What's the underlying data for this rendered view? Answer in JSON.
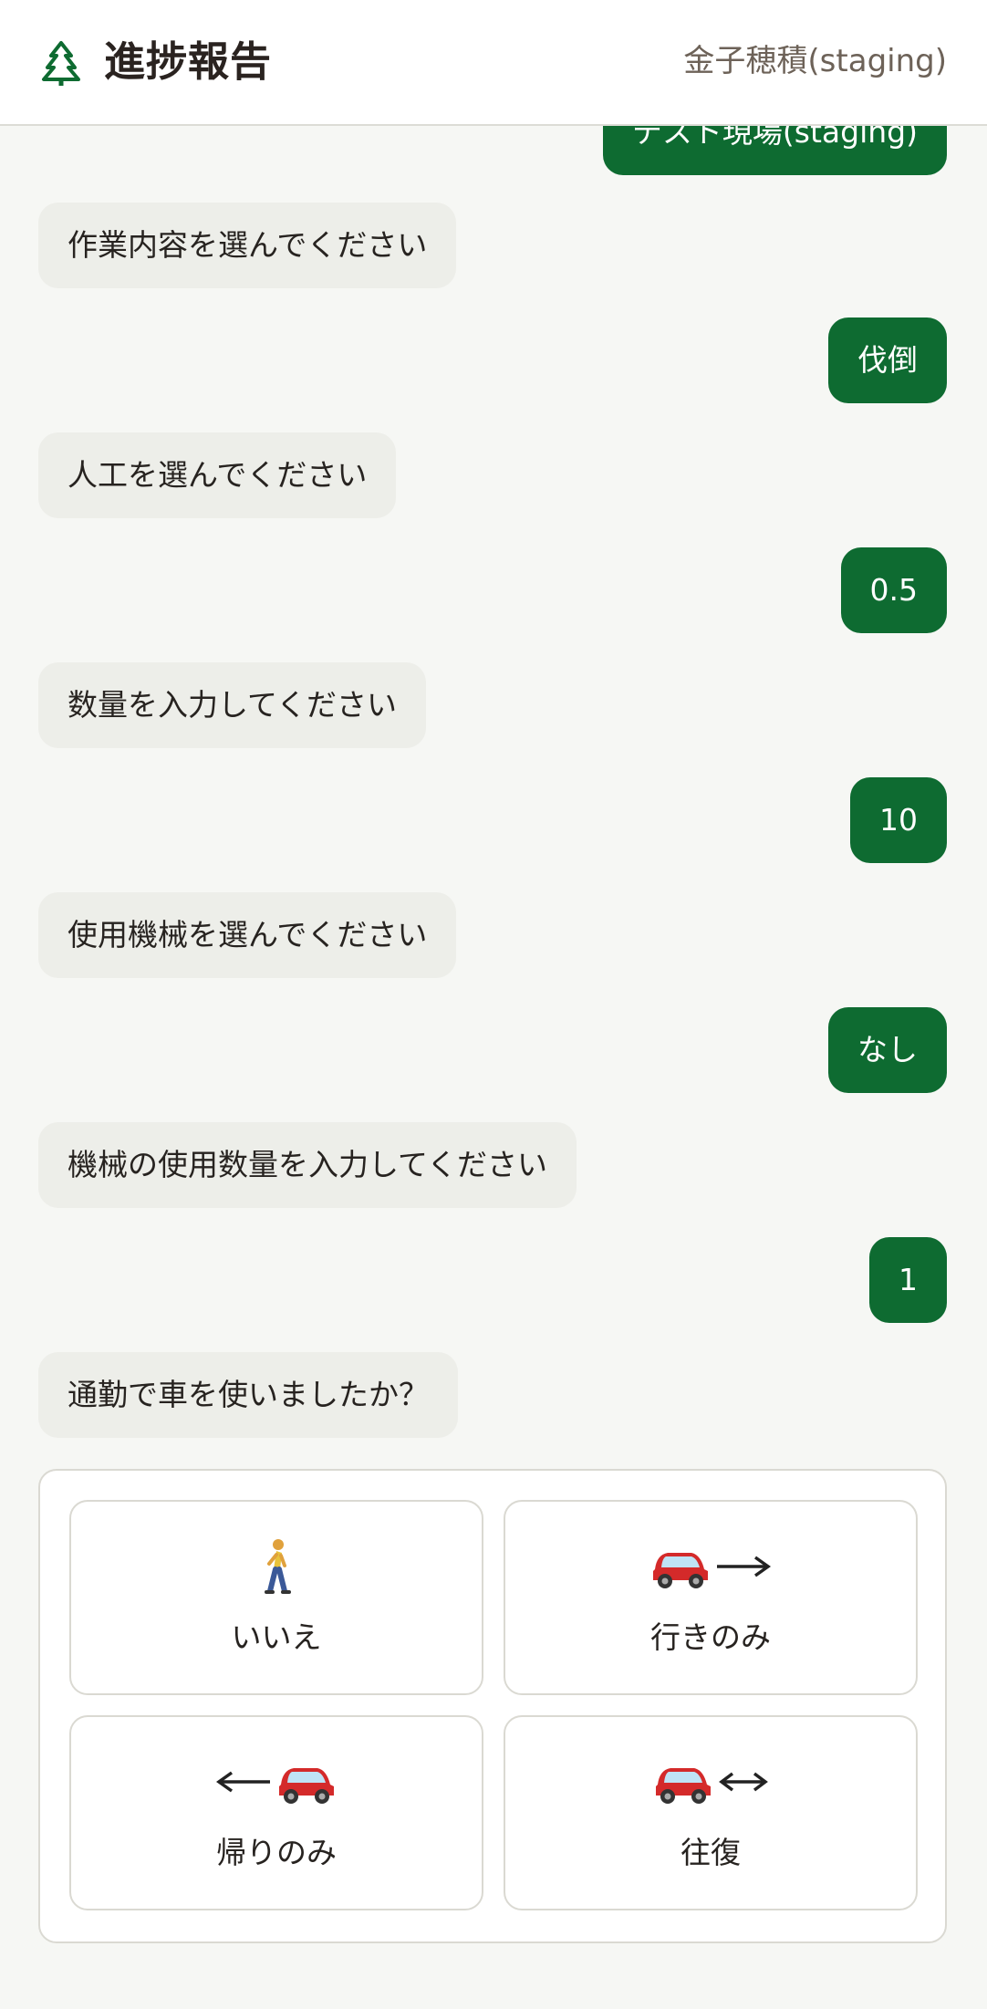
{
  "header": {
    "title": "進捗報告",
    "user": "金子穂積(staging)"
  },
  "messages": [
    {
      "role": "user",
      "text": "テスト現場(staging)"
    },
    {
      "role": "bot",
      "text": "作業内容を選んでください"
    },
    {
      "role": "user",
      "text": "伐倒"
    },
    {
      "role": "bot",
      "text": "人工を選んでください"
    },
    {
      "role": "user",
      "text": "0.5"
    },
    {
      "role": "bot",
      "text": "数量を入力してください"
    },
    {
      "role": "user",
      "text": "10"
    },
    {
      "role": "bot",
      "text": "使用機械を選んでください"
    },
    {
      "role": "user",
      "text": "なし"
    },
    {
      "role": "bot",
      "text": "機械の使用数量を入力してください"
    },
    {
      "role": "user",
      "text": "1"
    },
    {
      "role": "bot",
      "text": "通勤で車を使いましたか？"
    }
  ],
  "choices": [
    {
      "label": "いいえ",
      "icon": "walking-person-icon"
    },
    {
      "label": "行きのみ",
      "icon": "car-right-arrow-icon"
    },
    {
      "label": "帰りのみ",
      "icon": "left-arrow-car-icon"
    },
    {
      "label": "往復",
      "icon": "car-both-arrows-icon"
    }
  ],
  "colors": {
    "brand_green": "#0e6b31",
    "bot_bubble": "#edeee9",
    "background": "#f6f7f4",
    "car_red": "#d42a2a"
  }
}
